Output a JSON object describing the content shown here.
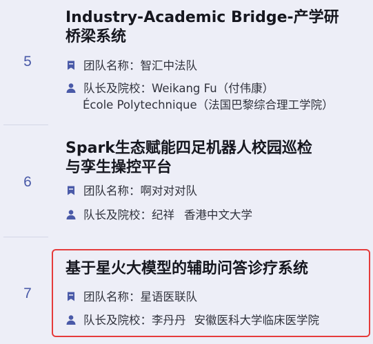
{
  "entries": [
    {
      "number": "5",
      "title_line1": "Industry-Academic Bridge-产学研",
      "title_line2": "桥梁系统",
      "team_label": "团队名称：",
      "team_name": "智汇中法队",
      "leader_label": "队长及院校：",
      "leader_name": "Weikang Fu（付伟康）",
      "school": "École Polytechnique（法国巴黎综合理工学院）"
    },
    {
      "number": "6",
      "title_line1": "Spark生态赋能四足机器人校园巡检",
      "title_line2": "与孪生操控平台",
      "team_label": "团队名称：",
      "team_name": "啊对对对队",
      "leader_label": "队长及院校：",
      "leader_name": "纪祥",
      "school": "香港中文大学"
    },
    {
      "number": "7",
      "title_line1": "基于星火大模型的辅助问答诊疗系统",
      "team_label": "团队名称：",
      "team_name": "星语医联队",
      "leader_label": "队长及院校：",
      "leader_name": "李丹丹",
      "school": "安徽医科大学临床医学院"
    }
  ],
  "icons": {
    "team": "bookmark-icon",
    "leader": "person-icon"
  },
  "colors": {
    "background": "#edeef7",
    "accent": "#4a5aa8",
    "highlight_border": "#e53b3b"
  }
}
